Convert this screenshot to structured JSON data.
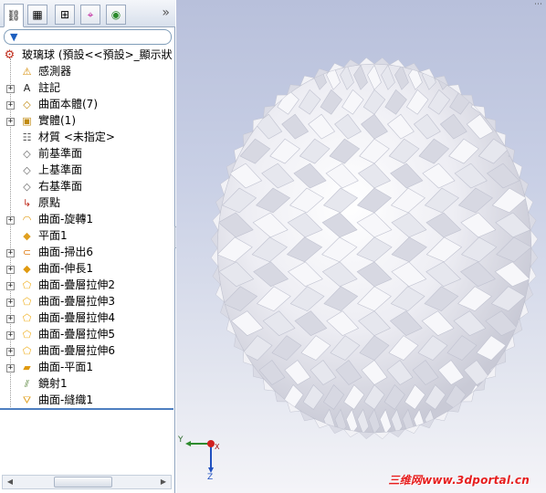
{
  "tabs": [
    {
      "name": "featuremanager",
      "glyph": "⛓"
    },
    {
      "name": "propertymanager",
      "glyph": "▦"
    },
    {
      "name": "configurationmanager",
      "glyph": "⊞"
    },
    {
      "name": "dimxpert",
      "glyph": "⌖"
    },
    {
      "name": "display",
      "glyph": "◉"
    }
  ],
  "tab_more": "»",
  "filter_glyph": "▼",
  "tree": {
    "root_label": "玻璃球 (預設<<預設>_顯示狀",
    "items": [
      {
        "label": "感測器",
        "icon": "sensor-icon",
        "glyph": "⚠",
        "expander": ""
      },
      {
        "label": "註記",
        "icon": "annotation-icon",
        "glyph": "A",
        "expander": "+"
      },
      {
        "label": "曲面本體(7)",
        "icon": "surface-bodies-folder-icon",
        "glyph": "◇",
        "expander": "+"
      },
      {
        "label": "實體(1)",
        "icon": "solid-bodies-folder-icon",
        "glyph": "▣",
        "expander": "+"
      },
      {
        "label": "材質 <未指定>",
        "icon": "material-icon",
        "glyph": "☷",
        "expander": ""
      },
      {
        "label": "前基準面",
        "icon": "plane-icon",
        "glyph": "◇",
        "expander": ""
      },
      {
        "label": "上基準面",
        "icon": "plane-icon",
        "glyph": "◇",
        "expander": ""
      },
      {
        "label": "右基準面",
        "icon": "plane-icon",
        "glyph": "◇",
        "expander": ""
      },
      {
        "label": "原點",
        "icon": "origin-icon",
        "glyph": "↳",
        "expander": ""
      },
      {
        "label": "曲面-旋轉1",
        "icon": "surface-revolve-icon",
        "glyph": "◠",
        "expander": "+"
      },
      {
        "label": "平面1",
        "icon": "plane1-icon",
        "glyph": "◆",
        "expander": ""
      },
      {
        "label": "曲面-掃出6",
        "icon": "surface-sweep-icon",
        "glyph": "⊂",
        "expander": "+"
      },
      {
        "label": "曲面-伸長1",
        "icon": "surface-extrude-icon",
        "glyph": "◆",
        "expander": "+"
      },
      {
        "label": "曲面-疊層拉伸2",
        "icon": "surface-loft-icon",
        "glyph": "⬠",
        "expander": "+"
      },
      {
        "label": "曲面-疊層拉伸3",
        "icon": "surface-loft-icon",
        "glyph": "⬠",
        "expander": "+"
      },
      {
        "label": "曲面-疊層拉伸4",
        "icon": "surface-loft-icon",
        "glyph": "⬠",
        "expander": "+"
      },
      {
        "label": "曲面-疊層拉伸5",
        "icon": "surface-loft-icon",
        "glyph": "⬠",
        "expander": "+"
      },
      {
        "label": "曲面-疊層拉伸6",
        "icon": "surface-loft-icon",
        "glyph": "⬠",
        "expander": "+"
      },
      {
        "label": "曲面-平面1",
        "icon": "surface-planar-icon",
        "glyph": "▰",
        "expander": "+"
      },
      {
        "label": "鏡射1",
        "icon": "mirror-icon",
        "glyph": "⫽",
        "expander": ""
      },
      {
        "label": "曲面-縫織1",
        "icon": "surface-knit-icon",
        "glyph": "⛛",
        "expander": ""
      }
    ]
  },
  "triad": {
    "x": "X",
    "y": "Y",
    "z": "Z"
  },
  "watermark": "三维网www.3dportal.cn",
  "colors": {
    "viewport_top": "#b8c0db",
    "viewport_bottom": "#f4f4f8",
    "model": "#ececf2",
    "icon_yellow": "#f0b020",
    "tree_line": "#4e7fc0",
    "watermark": "#e61e1e"
  }
}
